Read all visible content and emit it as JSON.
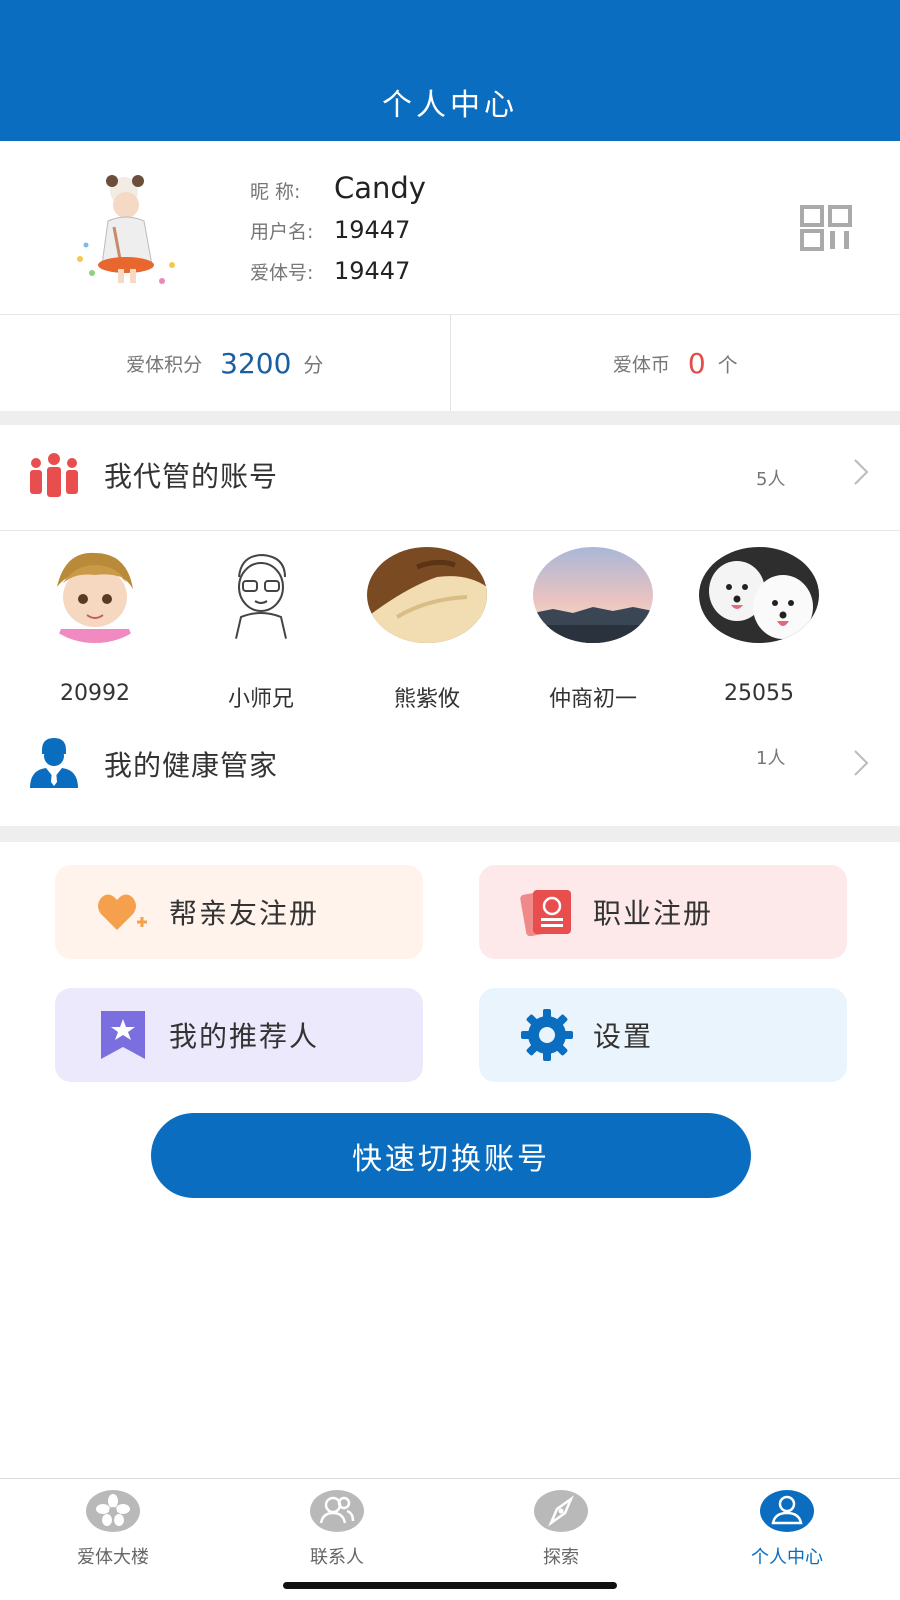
{
  "header": {
    "title": "个人中心"
  },
  "profile": {
    "nickname_label": "昵 称:",
    "nickname": "Candy",
    "username_label": "用户名:",
    "username": "19447",
    "aiti_id_label": "爱体号:",
    "aiti_id": "19447"
  },
  "stats": {
    "points_label": "爱体积分",
    "points_value": "3200",
    "points_unit": "分",
    "coins_label": "爱体币",
    "coins_value": "0",
    "coins_unit": "个"
  },
  "managed_accounts": {
    "title": "我代管的账号",
    "count": "5人",
    "items": [
      {
        "name": "20992"
      },
      {
        "name": "小师兄"
      },
      {
        "name": "熊紫攸"
      },
      {
        "name": "仲商初一"
      },
      {
        "name": "25055"
      }
    ]
  },
  "health_manager": {
    "title": "我的健康管家",
    "count": "1人"
  },
  "actions": {
    "register_friend": "帮亲友注册",
    "career_register": "职业注册",
    "my_referrer": "我的推荐人",
    "settings": "设置"
  },
  "switch_account": "快速切换账号",
  "tabs": [
    {
      "label": "爱体大楼",
      "icon": "flower-icon"
    },
    {
      "label": "联系人",
      "icon": "contacts-icon"
    },
    {
      "label": "探索",
      "icon": "compass-icon"
    },
    {
      "label": "个人中心",
      "icon": "user-icon",
      "active": true
    }
  ],
  "colors": {
    "primary": "#0a6dbf",
    "points": "#1a5fa0",
    "coins": "#e24c4c",
    "card_orange_bg": "#fff3ec",
    "card_pink_bg": "#fde8ea",
    "card_purple_bg": "#ebe9fb",
    "card_blue_bg": "#eaf4fc"
  }
}
